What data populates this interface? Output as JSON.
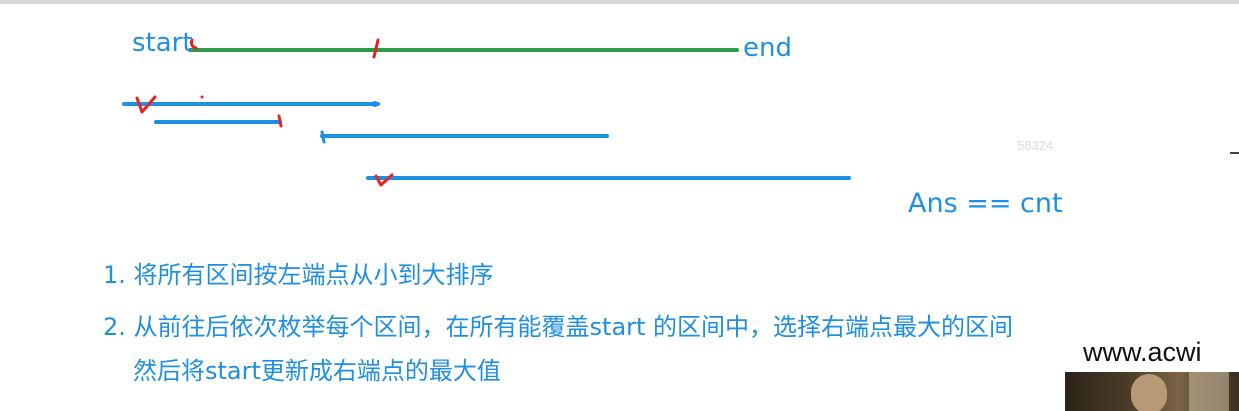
{
  "diagram": {
    "start_label": "start",
    "end_label": "end",
    "answer_text": "Ans == cnt",
    "watermark": "58324"
  },
  "steps": [
    "1. 将所有区间按左端点从小到大排序",
    "2. 从前往后依次枚举每个区间，在所有能覆盖start 的区间中，选择右端点最大的区间",
    "然后将start更新成右端点的最大值"
  ],
  "video_overlay": {
    "site_text": "www.acwi"
  },
  "colors": {
    "target_segment": "#2e9b4a",
    "interval_segment": "#1f8fe0",
    "annotation_red": "#e8231f",
    "text_blue": "#1f8fe0"
  }
}
